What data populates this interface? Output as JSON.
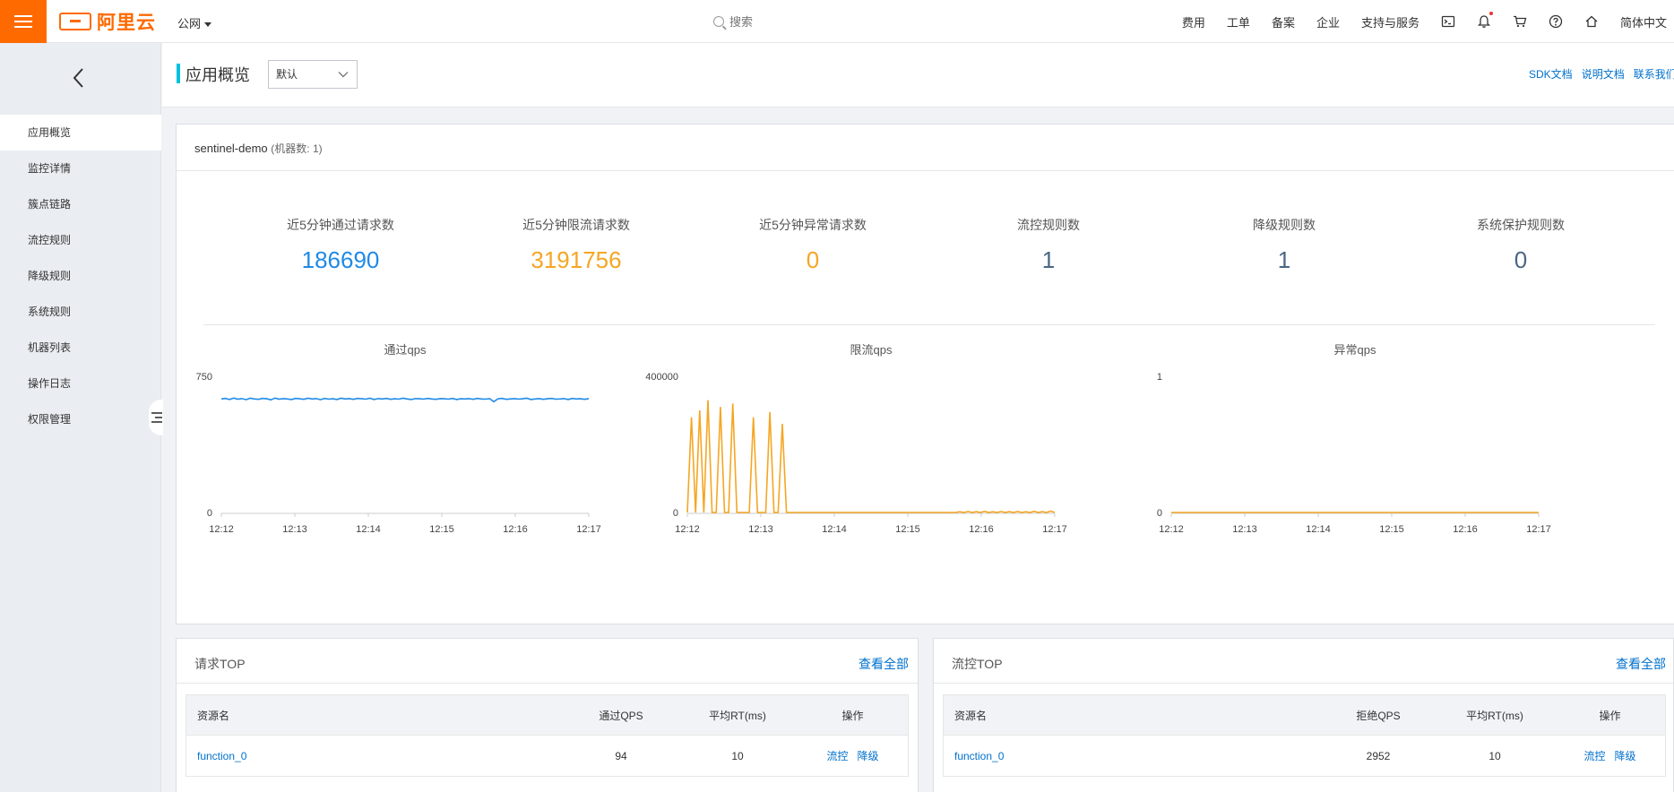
{
  "topbar": {
    "logo_text": "阿里云",
    "region": "公网",
    "search_placeholder": "搜索",
    "nav": [
      "费用",
      "工单",
      "备案",
      "企业",
      "支持与服务"
    ],
    "language": "简体中文"
  },
  "sidebar": {
    "items": [
      {
        "label": "应用概览",
        "active": true
      },
      {
        "label": "监控详情"
      },
      {
        "label": "簇点链路"
      },
      {
        "label": "流控规则"
      },
      {
        "label": "降级规则"
      },
      {
        "label": "系统规则"
      },
      {
        "label": "机器列表"
      },
      {
        "label": "操作日志"
      },
      {
        "label": "权限管理"
      }
    ]
  },
  "page": {
    "title": "应用概览",
    "select_value": "默认",
    "links": [
      "SDK文档",
      "说明文档",
      "联系我们"
    ]
  },
  "overview": {
    "app_name": "sentinel-demo",
    "machine_count": "(机器数: 1)",
    "stats": [
      {
        "label": "近5分钟通过请求数",
        "value": "186690",
        "color": "#1f8ae6"
      },
      {
        "label": "近5分钟限流请求数",
        "value": "3191756",
        "color": "#f5a623"
      },
      {
        "label": "近5分钟异常请求数",
        "value": "0",
        "color": "#f5a623"
      },
      {
        "label": "流控规则数",
        "value": "1",
        "color": "#4a6785"
      },
      {
        "label": "降级规则数",
        "value": "1",
        "color": "#4a6785"
      },
      {
        "label": "系统保护规则数",
        "value": "0",
        "color": "#4a6785"
      }
    ]
  },
  "chart_data": [
    {
      "type": "line",
      "title": "通过qps",
      "color": "#1f8ae6",
      "x_ticks": [
        "12:12",
        "12:13",
        "12:14",
        "12:15",
        "12:16",
        "12:17"
      ],
      "ylim": [
        0,
        750
      ],
      "y_ticks": [
        "0",
        "750"
      ],
      "series": [
        {
          "values": [
            625,
            628,
            622,
            630,
            624,
            627,
            621,
            629,
            625,
            623,
            628,
            626,
            620,
            630,
            624,
            627,
            625,
            622,
            628,
            626,
            623,
            629,
            625,
            627,
            621,
            628,
            624,
            626,
            622,
            629,
            625,
            627,
            623,
            628,
            626,
            624,
            629,
            622,
            627,
            625,
            628,
            623,
            626,
            624,
            629,
            625,
            622,
            627,
            626,
            624,
            628,
            625,
            623,
            627,
            626,
            624,
            628,
            622,
            626,
            625,
            627,
            623,
            628,
            625,
            624,
            627,
            610,
            626,
            628,
            623,
            625,
            627,
            624,
            626,
            629,
            622,
            625,
            627,
            623,
            626,
            628,
            624,
            625,
            627,
            622,
            628,
            625,
            626,
            623,
            627
          ]
        }
      ]
    },
    {
      "type": "line",
      "title": "限流qps",
      "color": "#f5a623",
      "x_ticks": [
        "12:12",
        "12:13",
        "12:14",
        "12:15",
        "12:16",
        "12:17"
      ],
      "ylim": [
        0,
        400000
      ],
      "y_ticks": [
        "0",
        "400000"
      ],
      "series": [
        {
          "values": [
            0,
            280000,
            0,
            300000,
            0,
            330000,
            0,
            0,
            310000,
            0,
            0,
            320000,
            0,
            0,
            0,
            0,
            280000,
            0,
            0,
            0,
            295000,
            0,
            0,
            260000,
            0,
            0,
            0,
            0,
            0,
            0,
            0,
            0,
            0,
            0,
            0,
            0,
            0,
            0,
            0,
            0,
            0,
            0,
            0,
            0,
            0,
            0,
            0,
            0,
            0,
            0,
            0,
            0,
            0,
            0,
            0,
            0,
            0,
            0,
            0,
            0,
            0,
            0,
            0,
            0,
            0,
            0,
            2000,
            0,
            3000,
            0,
            2500,
            0,
            3500,
            0,
            2000,
            0,
            3000,
            0,
            2500,
            0,
            3000,
            0,
            2000,
            0,
            3500,
            0,
            2500,
            0,
            4000,
            0
          ]
        }
      ]
    },
    {
      "type": "line",
      "title": "异常qps",
      "color": "#f5a623",
      "x_ticks": [
        "12:12",
        "12:13",
        "12:14",
        "12:15",
        "12:16",
        "12:17"
      ],
      "ylim": [
        0,
        1
      ],
      "y_ticks": [
        "0",
        "1"
      ],
      "series": [
        {
          "values": [
            0,
            0,
            0,
            0,
            0,
            0,
            0,
            0,
            0,
            0,
            0,
            0,
            0,
            0,
            0,
            0,
            0,
            0,
            0,
            0
          ]
        }
      ]
    }
  ],
  "request_top": {
    "title": "请求TOP",
    "view_all": "查看全部",
    "columns": [
      "资源名",
      "通过QPS",
      "平均RT(ms)",
      "操作"
    ],
    "rows": [
      {
        "name": "function_0",
        "qps": "94",
        "rt": "10",
        "op1": "流控",
        "op2": "降级"
      }
    ]
  },
  "flow_top": {
    "title": "流控TOP",
    "view_all": "查看全部",
    "columns": [
      "资源名",
      "拒绝QPS",
      "平均RT(ms)",
      "操作"
    ],
    "rows": [
      {
        "name": "function_0",
        "qps": "2952",
        "rt": "10",
        "op1": "流控",
        "op2": "降级"
      }
    ]
  }
}
